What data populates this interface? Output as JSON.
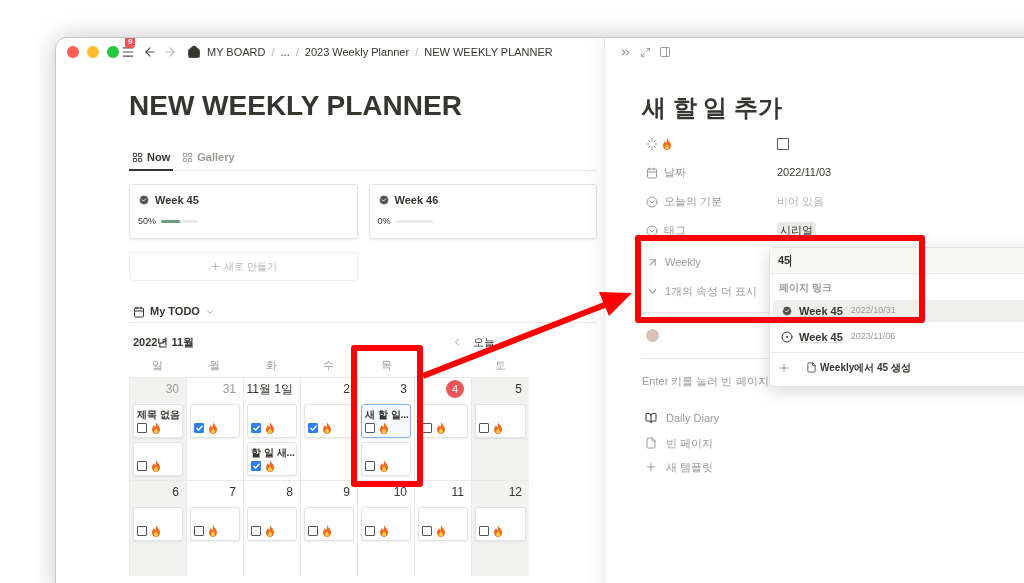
{
  "window": {
    "badge": "9",
    "separator": "/",
    "breadcrumb": [
      "MY BOARD",
      "...",
      "2023 Weekly Planner",
      "NEW WEEKLY PLANNER"
    ]
  },
  "page": {
    "title": "NEW WEEKLY PLANNER",
    "tabs": [
      {
        "label": "Now",
        "selected": true
      },
      {
        "label": "Gallery",
        "selected": false
      }
    ],
    "weeks": [
      {
        "title": "Week 45",
        "reading": "50%",
        "level": 0.5
      },
      {
        "title": "Week 46",
        "reading": "0%",
        "level": 0
      }
    ],
    "new_button": "새로 만들기"
  },
  "calendar": {
    "view": "My TODO",
    "month": "2022년 11월",
    "today_button": "오늘",
    "weekdays": [
      {
        "label": "일",
        "weekend": true
      },
      {
        "label": "월",
        "weekend": false
      },
      {
        "label": "화",
        "weekend": false
      },
      {
        "label": "수",
        "weekend": false
      },
      {
        "label": "목",
        "weekend": false
      },
      {
        "weekend": false
      },
      {
        "label": "토",
        "weekend": true
      }
    ],
    "weeks": [
      [
        {
          "day": "30",
          "muted": true,
          "today": false,
          "items": [
            {
              "title": "제목 없음",
              "checked": false,
              "selected": false
            },
            {
              "checked": false,
              "selected": false
            }
          ]
        },
        {
          "day": "31",
          "muted": true,
          "today": false,
          "items": [
            {
              "checked": true,
              "selected": false
            }
          ]
        },
        {
          "day": "11월 1일",
          "muted": false,
          "today": false,
          "items": [
            {
              "checked": true,
              "selected": false
            },
            {
              "title": "할 일 새...",
              "checked": true,
              "selected": false
            }
          ]
        },
        {
          "day": "2",
          "muted": false,
          "today": false,
          "items": [
            {
              "checked": true,
              "selected": false
            }
          ]
        },
        {
          "day": "3",
          "muted": false,
          "today": false,
          "items": [
            {
              "title": "새 할 일...",
              "checked": false,
              "selected": true
            },
            {
              "checked": false,
              "selected": false
            }
          ]
        },
        {
          "day": "4",
          "muted": false,
          "today": true,
          "items": [
            {
              "checked": false,
              "selected": false
            }
          ]
        },
        {
          "day": "5",
          "muted": false,
          "today": false,
          "items": [
            {
              "checked": false,
              "selected": false
            }
          ]
        }
      ],
      [
        {
          "day": "6",
          "muted": false,
          "today": false,
          "items": [
            {
              "checked": false,
              "selected": false
            }
          ]
        },
        {
          "day": "7",
          "muted": false,
          "today": false,
          "items": [
            {
              "checked": false,
              "selected": false
            }
          ]
        },
        {
          "day": "8",
          "muted": false,
          "today": false,
          "items": [
            {
              "checked": false,
              "selected": false
            }
          ]
        },
        {
          "day": "9",
          "muted": false,
          "today": false,
          "items": [
            {
              "checked": false,
              "selected": false
            }
          ]
        },
        {
          "day": "10",
          "muted": false,
          "today": false,
          "items": [
            {
              "checked": false,
              "selected": false
            }
          ]
        },
        {
          "day": "11",
          "muted": false,
          "today": false,
          "items": [
            {
              "checked": false,
              "selected": false
            }
          ]
        },
        {
          "day": "12",
          "muted": false,
          "today": false,
          "items": [
            {
              "checked": false,
              "selected": false
            }
          ]
        }
      ]
    ]
  },
  "panel": {
    "title": "새 할 일 추가",
    "properties": [
      {
        "kind": "checkbox",
        "checked": false
      },
      {
        "kind": "date",
        "label": "날짜",
        "value": "2022/11/03"
      },
      {
        "kind": "select",
        "label": "오늘의 기분",
        "placeholder": "비어 있음"
      },
      {
        "kind": "tag",
        "label": "태그",
        "value": "시리얼"
      },
      {
        "kind": "relation",
        "label": "Weekly"
      },
      {
        "kind": "more",
        "label": "1개의 속성 더 표시"
      }
    ],
    "hint": "Enter 키를 눌러 빈 페이지",
    "templates": [
      {
        "kind": "diary",
        "label": "Daily Diary"
      },
      {
        "kind": "blank",
        "label": "빈 페이지"
      },
      {
        "kind": "new",
        "label": "새 템플릿"
      }
    ]
  },
  "dropdown": {
    "query": "45",
    "section": "페이지 링크",
    "options": [
      {
        "kind": "done",
        "title": "Week 45",
        "date": "2022/10/31",
        "selected": true
      },
      {
        "kind": "open",
        "title": "Week 45",
        "date": "2023/11/06",
        "selected": false
      }
    ],
    "create": "Weekly에서 45 생성"
  }
}
